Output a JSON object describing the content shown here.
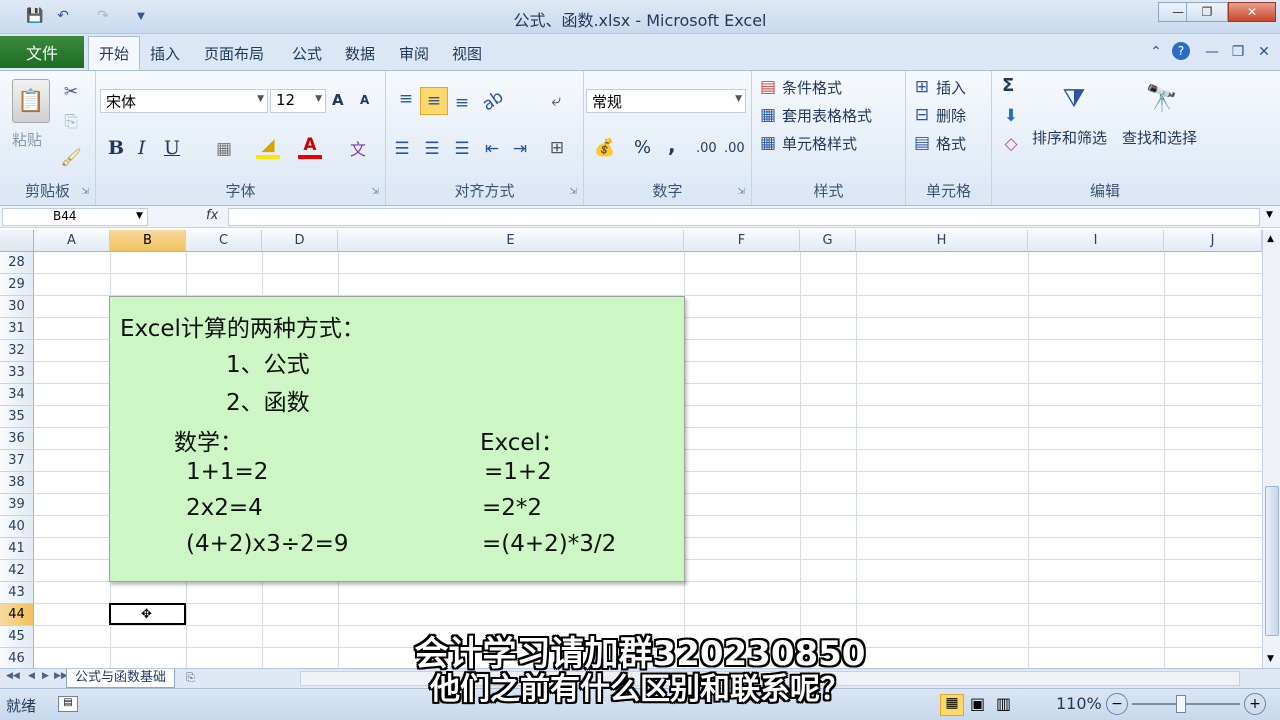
{
  "window": {
    "title": "公式、函数.xlsx - Microsoft Excel"
  },
  "quick_access": {
    "save": "save-icon",
    "undo": "undo-icon",
    "redo": "redo-icon",
    "customize": "▼"
  },
  "tabs": {
    "file": "文件",
    "home": "开始",
    "insert": "插入",
    "page_layout": "页面布局",
    "formulas": "公式",
    "data": "数据",
    "review": "审阅",
    "view": "视图"
  },
  "ribbon": {
    "clipboard": {
      "label": "剪贴板",
      "paste": "粘贴"
    },
    "font": {
      "label": "字体",
      "name": "宋体",
      "size": "12",
      "bold": "B",
      "italic": "I",
      "underline": "U",
      "grow": "A",
      "shrink": "A"
    },
    "alignment": {
      "label": "对齐方式"
    },
    "number": {
      "label": "数字",
      "format": "常规",
      "percent": "%",
      "comma": ",",
      "inc_dec": ".00",
      "dec_dec": ".00"
    },
    "styles": {
      "label": "样式",
      "conditional": "条件格式",
      "table": "套用表格格式",
      "cell": "单元格样式"
    },
    "cells": {
      "label": "单元格",
      "insert": "插入",
      "delete": "删除",
      "format": "格式"
    },
    "editing": {
      "label": "编辑",
      "sum": "Σ",
      "sort": "排序和筛选",
      "find": "查找和选择"
    }
  },
  "formula_bar": {
    "name_box": "B44",
    "fx": "fx",
    "value": ""
  },
  "columns": [
    "A",
    "B",
    "C",
    "D",
    "E",
    "F",
    "G",
    "H",
    "I",
    "J"
  ],
  "rows": [
    "28",
    "29",
    "30",
    "31",
    "32",
    "33",
    "34",
    "35",
    "36",
    "37",
    "38",
    "39",
    "40",
    "41",
    "42",
    "43",
    "44",
    "45",
    "46"
  ],
  "selected_col": "B",
  "selected_row": "44",
  "textbox": {
    "title": "Excel计算的两种方式：",
    "item1": "1、公式",
    "item2": "2、函数",
    "math_header": "数学：",
    "excel_header": "Excel：",
    "math1": "1+1=2",
    "math2": "2x2=4",
    "math3": "(4+2)x3÷2=9",
    "excel1": "=1+2",
    "excel2": "=2*2",
    "excel3": "=(4+2)*3/2"
  },
  "sheet_tab": "公式与函数基础",
  "status": {
    "ready": "就绪",
    "zoom": "110%"
  },
  "subtitles": {
    "line1": "会计学习请加群320230850",
    "line2": "他们之前有什么区别和联系呢？"
  },
  "colors": {
    "textbox_bg": "#ccf7c4",
    "file_tab": "#2a7a2e",
    "selected_header": "#f1c15f"
  }
}
